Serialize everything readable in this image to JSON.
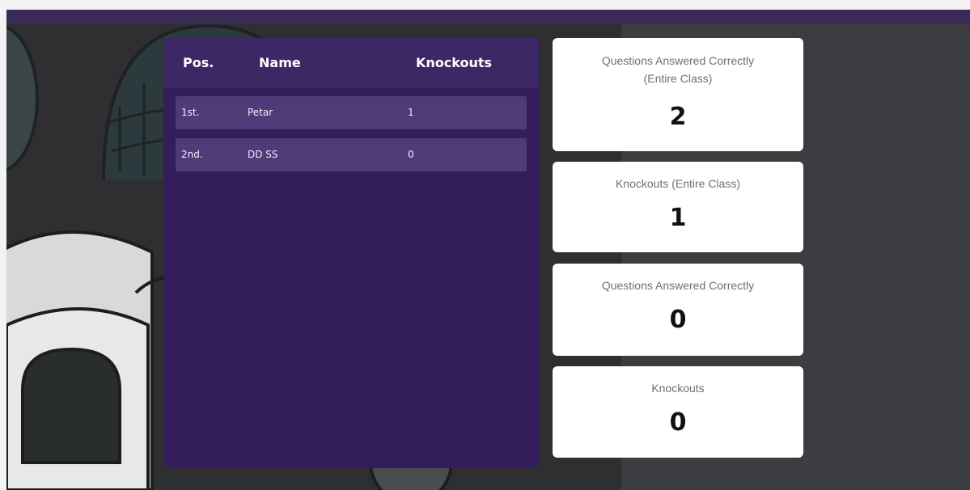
{
  "leaderboard": {
    "headers": {
      "pos": "Pos.",
      "name": "Name",
      "knockouts": "Knockouts"
    },
    "rows": [
      {
        "pos": "1st.",
        "name": "Petar",
        "knockouts": "1"
      },
      {
        "pos": "2nd.",
        "name": "DD SS",
        "knockouts": "0"
      }
    ]
  },
  "stats": [
    {
      "label": "Questions Answered Correctly\n(Entire Class)",
      "value": "2"
    },
    {
      "label": "Knockouts (Entire Class)",
      "value": "1"
    },
    {
      "label": "Questions Answered Correctly",
      "value": "0"
    },
    {
      "label": "Knockouts",
      "value": "0"
    }
  ],
  "colors": {
    "board_bg": "#341d5b",
    "board_header": "#3d2866",
    "row_bg": "#4f3b78",
    "card_bg": "#ffffff",
    "backdrop": "#2f2e31"
  },
  "icons": [
    "igloo-illustration",
    "snowman-illustration",
    "character-illustration"
  ]
}
